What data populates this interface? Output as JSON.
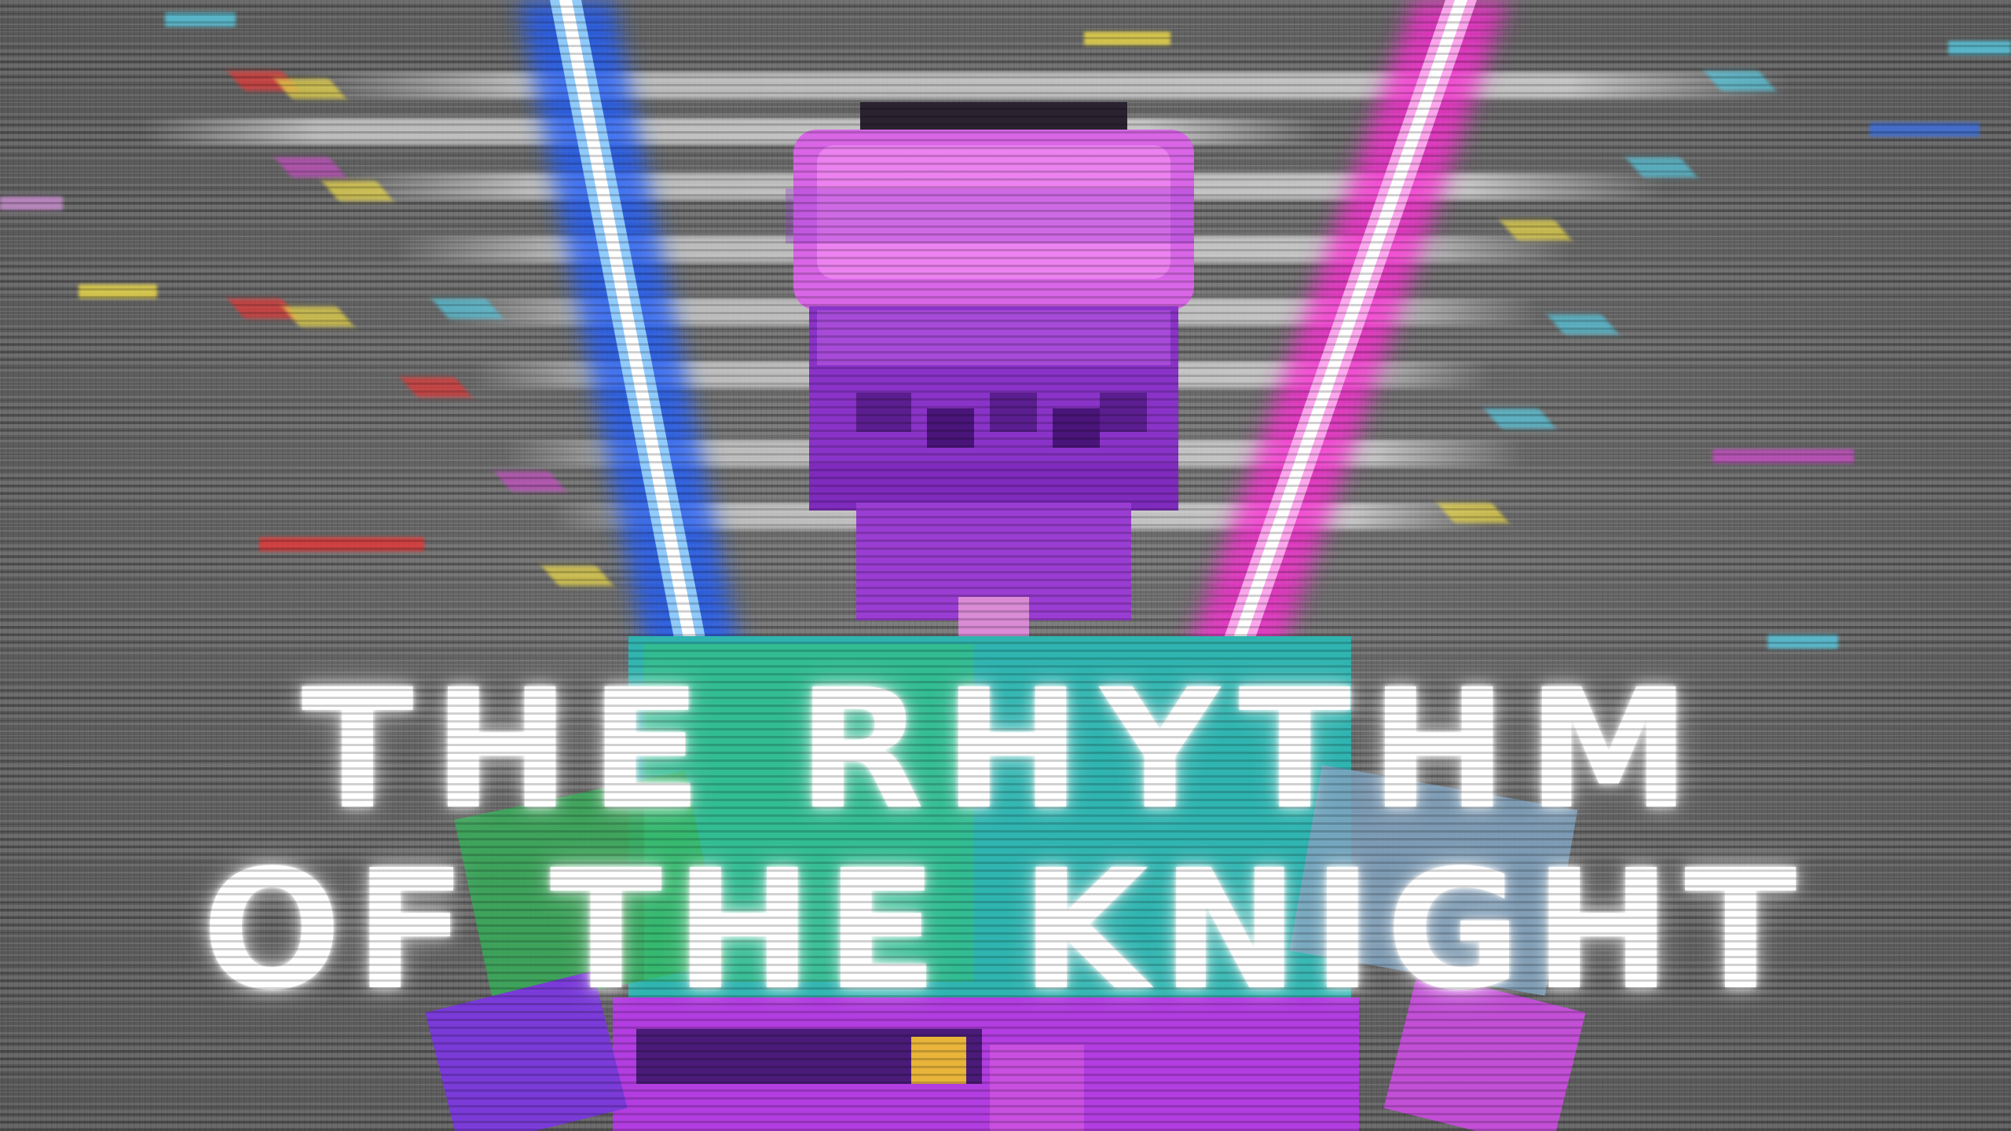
{
  "title": {
    "line1": "THE RHYTHM",
    "line2": "OF THE KNIGHT"
  },
  "colors": {
    "background": "#6f6f6f",
    "blade_left": "#1f5cff",
    "blade_right": "#ff2bd6",
    "helmet": "#e06ee8",
    "armor_top": "#2fc8b8",
    "armor_bottom": "#b23de0",
    "title_text": "#ffffff"
  },
  "icons": {
    "knight": "pixel-knight-icon"
  }
}
